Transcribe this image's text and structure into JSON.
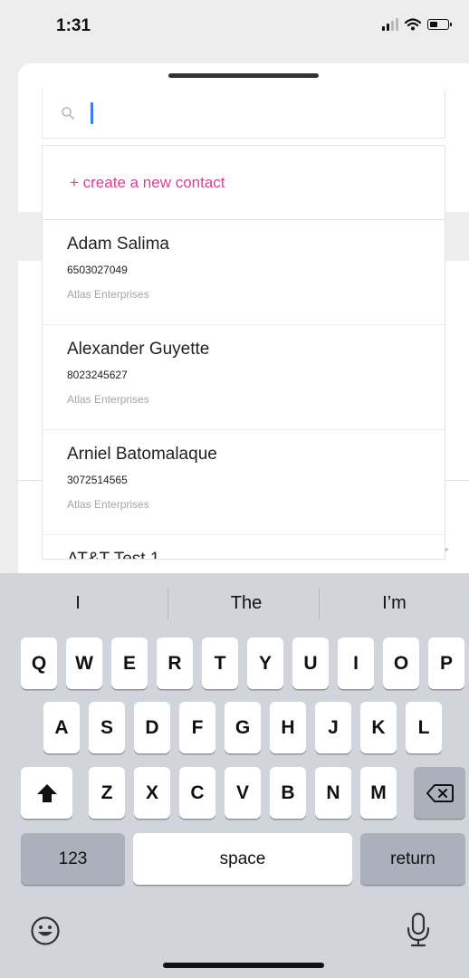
{
  "status_bar": {
    "time": "1:31"
  },
  "search": {
    "placeholder": ""
  },
  "create_contact": {
    "label": "+ create a new contact"
  },
  "contacts": [
    {
      "name": "Adam Salima",
      "phone": "6503027049",
      "company": "Atlas Enterprises"
    },
    {
      "name": "Alexander Guyette",
      "phone": "8023245627",
      "company": "Atlas Enterprises"
    },
    {
      "name": "Arniel Batomalaque",
      "phone": "3072514565",
      "company": "Atlas Enterprises"
    },
    {
      "name": "AT&T Test 1",
      "phone": "",
      "company": ""
    }
  ],
  "keyboard": {
    "suggestions": [
      "I",
      "The",
      "I’m"
    ],
    "row1": [
      "Q",
      "W",
      "E",
      "R",
      "T",
      "Y",
      "U",
      "I",
      "O",
      "P"
    ],
    "row2": [
      "A",
      "S",
      "D",
      "F",
      "G",
      "H",
      "J",
      "K",
      "L"
    ],
    "row3": [
      "Z",
      "X",
      "C",
      "V",
      "B",
      "N",
      "M"
    ],
    "numbers_label": "123",
    "space_label": "space",
    "return_label": "return"
  },
  "colors": {
    "accent_pink": "#e23d8a",
    "caret_blue": "#3a7bf6",
    "keyboard_bg": "#d1d4db"
  },
  "icons": [
    "signal-icon",
    "wifi-icon",
    "battery-icon",
    "search-icon",
    "shift-icon",
    "backspace-icon",
    "emoji-icon",
    "microphone-icon"
  ]
}
